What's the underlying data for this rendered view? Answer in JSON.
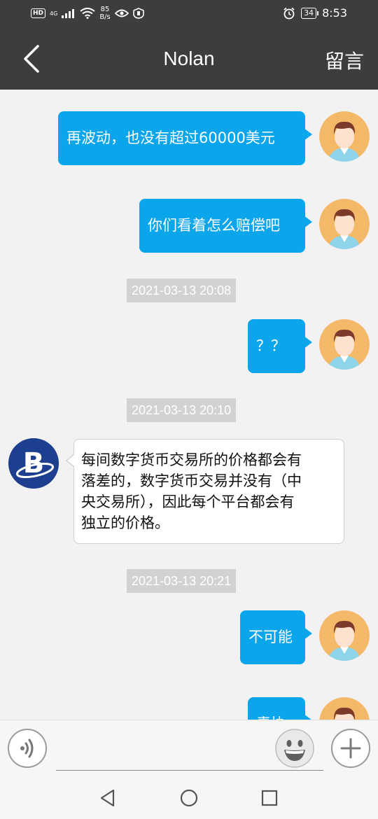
{
  "status_bar": {
    "hd": "HD",
    "network": "4G",
    "speed_value": "85",
    "speed_unit": "B/s",
    "battery": "34",
    "time": "8:53"
  },
  "header": {
    "title": "Nolan",
    "action_label": "留言",
    "background": "#3b3d3e"
  },
  "colors": {
    "bubble_out": "#0aa5ea",
    "timestamp_bg": "#d2d2d2",
    "chat_bg": "#f2f2f2"
  },
  "messages": [
    {
      "sender": "me",
      "text": "再波动，也没有超过60000美元"
    },
    {
      "sender": "me",
      "text": "你们看着怎么赔偿吧"
    },
    {
      "timestamp": "2021-03-13 20:08"
    },
    {
      "sender": "me",
      "text": "？？"
    },
    {
      "timestamp": "2021-03-13 20:10"
    },
    {
      "sender": "agent",
      "avatar_letter": "B",
      "lines": [
        "每间数字货币交易所的价格都会有",
        "落差的，数字货币交易并没有（中",
        "央交易所），因此每个平台都会有",
        "独立的价格。"
      ]
    },
    {
      "timestamp": "2021-03-13 20:21"
    },
    {
      "sender": "me",
      "text": "不可能"
    },
    {
      "sender": "me",
      "text": "青协"
    }
  ],
  "input_bar": {
    "voice_icon": "voice-icon",
    "emoji_icon": "emoji-icon",
    "plus_icon": "plus-icon",
    "placeholder": ""
  },
  "nav_bar": {
    "icons": [
      "back-triangle-icon",
      "home-circle-icon",
      "recents-square-icon"
    ]
  }
}
